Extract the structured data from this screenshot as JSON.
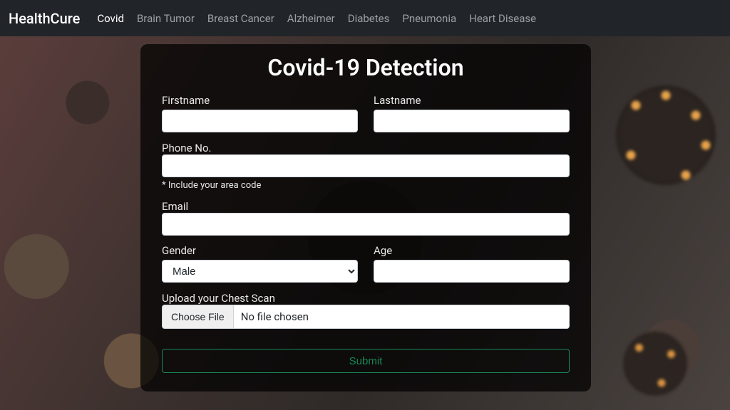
{
  "nav": {
    "brand": "HealthCure",
    "items": [
      {
        "label": "Covid",
        "active": true
      },
      {
        "label": "Brain Tumor",
        "active": false
      },
      {
        "label": "Breast Cancer",
        "active": false
      },
      {
        "label": "Alzheimer",
        "active": false
      },
      {
        "label": "Diabetes",
        "active": false
      },
      {
        "label": "Pneumonia",
        "active": false
      },
      {
        "label": "Heart Disease",
        "active": false
      }
    ]
  },
  "form": {
    "title": "Covid-19 Detection",
    "firstname_label": "Firstname",
    "lastname_label": "Lastname",
    "phone_label": "Phone No.",
    "phone_hint": "* Include your area code",
    "email_label": "Email",
    "gender_label": "Gender",
    "gender_value": "Male",
    "age_label": "Age",
    "upload_label": "Upload your Chest Scan",
    "choose_file_label": "Choose File",
    "file_status": "No file chosen",
    "submit_label": "Submit",
    "firstname_value": "",
    "lastname_value": "",
    "phone_value": "",
    "email_value": "",
    "age_value": ""
  },
  "colors": {
    "accent": "#198754",
    "navbar": "#212529"
  }
}
